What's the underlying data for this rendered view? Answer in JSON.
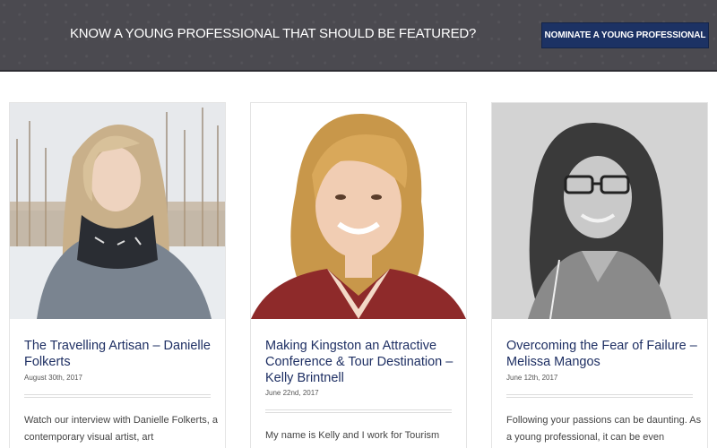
{
  "banner": {
    "text": "KNOW A YOUNG PROFESSIONAL THAT SHOULD BE FEATURED?",
    "button_label": "NOMINATE A YOUNG PROFESSIONAL"
  },
  "colors": {
    "banner_bg": "#4b4a50",
    "button_bg": "#1c3264",
    "title_color": "#1e2f63"
  },
  "cards": [
    {
      "title": "The Travelling Artisan – Danielle Folkerts",
      "date": "August 30th, 2017",
      "excerpt": "Watch our interview with Danielle Folkerts, a contemporary visual artist, art"
    },
    {
      "title": "Making Kingston an Attractive Conference & Tour Destination – Kelly Brintnell",
      "date": "June 22nd, 2017",
      "excerpt": "My name is Kelly and I work for Tourism"
    },
    {
      "title": "Overcoming the Fear of Failure – Melissa Mangos",
      "date": "June 12th, 2017",
      "excerpt": "Following your passions can be daunting. As a young professional, it can be even"
    }
  ]
}
